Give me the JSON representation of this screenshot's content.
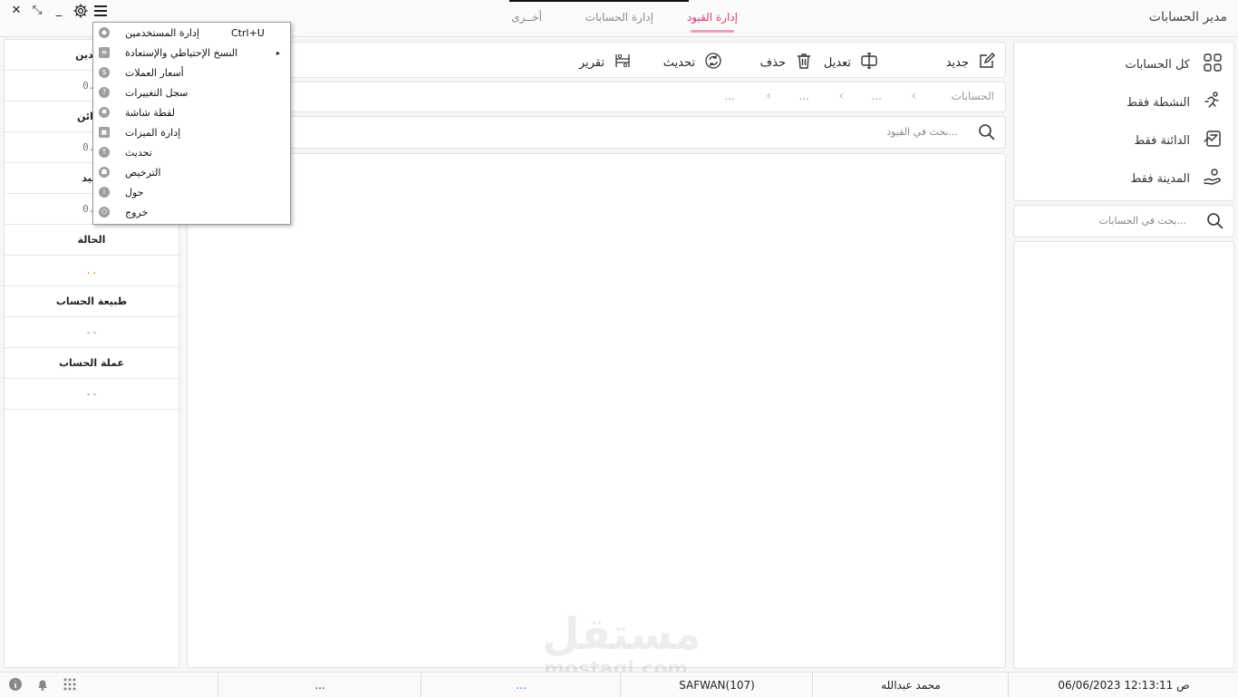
{
  "app": {
    "title": "مدير الحسابات"
  },
  "tabs": [
    {
      "label": "إدارة القيود",
      "active": true
    },
    {
      "label": "إدارة الحسابات",
      "active": false
    },
    {
      "label": "أخــرى",
      "active": false
    }
  ],
  "window_controls": {
    "close": "✕",
    "restore": "⤡",
    "minimize": "_"
  },
  "filters": [
    {
      "label": "كل الحسابات",
      "icon": "grid-icon"
    },
    {
      "label": "النشطة فقط",
      "icon": "runner-icon"
    },
    {
      "label": "الدائنة فقط",
      "icon": "credit-icon"
    },
    {
      "label": "المدينة فقط",
      "icon": "debit-icon"
    }
  ],
  "account_search": {
    "placeholder": "بحث في الحسابات..."
  },
  "toolbar": {
    "new": "جديد",
    "edit": "تعديل",
    "delete": "حذف",
    "refresh": "تحديث",
    "report": "تقرير"
  },
  "breadcrumb": {
    "root": "الحسابات",
    "items": [
      "...",
      "...",
      "..."
    ]
  },
  "entries_search": {
    "placeholder": "بحث في القيود..."
  },
  "details": [
    {
      "label": "المدين",
      "value": "0.0"
    },
    {
      "label": "الدائن",
      "value": "0.0"
    },
    {
      "label": "صيد",
      "value": "0.0"
    },
    {
      "label": "الحالة",
      "value": ".."
    },
    {
      "label": "طبيعة الحساب",
      "value": "--"
    },
    {
      "label": "عملة الحساب",
      "value": "--"
    }
  ],
  "menu": {
    "items": [
      {
        "label": "إدارة المستخدمين",
        "shortcut": "Ctrl+U",
        "icon": "users-icon"
      },
      {
        "label": "النسخ الإحتياطي والإستعادة",
        "submenu": "▸",
        "icon": "backup-icon"
      },
      {
        "label": "أسعار العملات",
        "icon": "currency-icon"
      },
      {
        "label": "سجل التغييرات",
        "icon": "changelog-icon"
      },
      {
        "label": "لقطة شاشة",
        "icon": "screenshot-icon"
      },
      {
        "label": "إدارة الميزات",
        "icon": "features-icon"
      },
      {
        "label": "تحديث",
        "icon": "update-icon"
      },
      {
        "label": "الترخيص",
        "icon": "license-icon"
      },
      {
        "label": "حول",
        "icon": "about-icon"
      },
      {
        "label": "خروج",
        "icon": "exit-icon"
      }
    ]
  },
  "status": {
    "datetime": "06/06/2023 12:13:11 ص",
    "user": "محمد عبدالله",
    "station": "SAFWAN(107)",
    "cell4": "...",
    "cell5": "..."
  },
  "watermark": {
    "text": "مستقل",
    "domain": "mostaql.com"
  },
  "colors": {
    "accent": "#e0367a",
    "accent_underline": "#f29ac0"
  }
}
